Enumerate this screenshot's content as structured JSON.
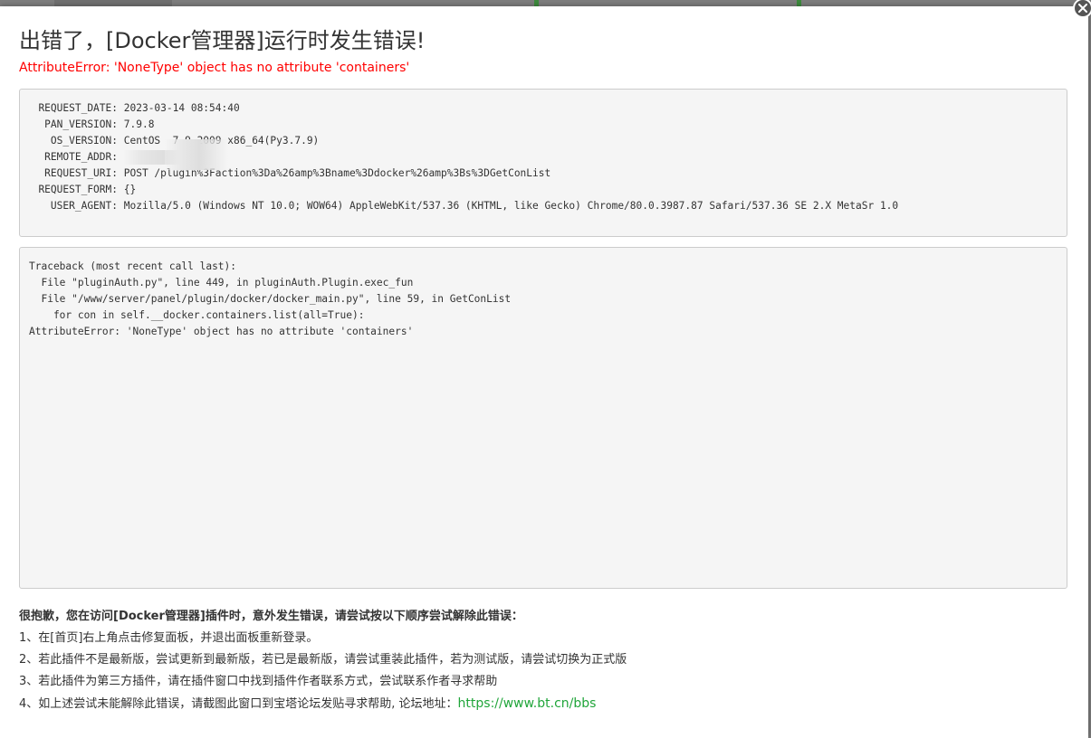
{
  "dialog": {
    "title": "出错了，[Docker管理器]运行时发生错误!",
    "error_message": "AttributeError: 'NoneType' object has no attribute 'containers'"
  },
  "request_info": [
    {
      "key": "REQUEST_DATE:",
      "value": "2023-03-14 08:54:40"
    },
    {
      "key": "PAN_VERSION:",
      "value": "7.9.8"
    },
    {
      "key": "OS_VERSION:",
      "value": "CentOS  7.9.2009 x86_64(Py3.7.9)"
    },
    {
      "key": "REMOTE_ADDR:",
      "value": ""
    },
    {
      "key": "REQUEST_URI:",
      "value": "POST /plugin%3Faction%3Da%26amp%3Bname%3Ddocker%26amp%3Bs%3DGetConList"
    },
    {
      "key": "REQUEST_FORM:",
      "value": "{}"
    },
    {
      "key": "USER_AGENT:",
      "value": "Mozilla/5.0 (Windows NT 10.0; WOW64) AppleWebKit/537.36 (KHTML, like Gecko) Chrome/80.0.3987.87 Safari/537.36 SE 2.X MetaSr 1.0"
    }
  ],
  "traceback": [
    "Traceback (most recent call last):",
    "  File \"pluginAuth.py\", line 449, in pluginAuth.Plugin.exec_fun",
    "  File \"/www/server/panel/plugin/docker/docker_main.py\", line 59, in GetConList",
    "    for con in self.__docker.containers.list(all=True):",
    "AttributeError: 'NoneType' object has no attribute 'containers'"
  ],
  "help": {
    "title": "很抱歉，您在访问[Docker管理器]插件时，意外发生错误，请尝试按以下顺序尝试解除此错误：",
    "items": [
      "1、在[首页]右上角点击修复面板，并退出面板重新登录。",
      "2、若此插件不是最新版，尝试更新到最新版，若已是最新版，请尝试重装此插件，若为测试版，请尝试切换为正式版",
      "3、若此插件为第三方插件，请在插件窗口中找到插件作者联系方式，尝试联系作者寻求帮助",
      "4、如上述尝试未能解除此错误，请截图此窗口到宝塔论坛发贴寻求帮助, 论坛地址："
    ],
    "forum_link": "https://www.bt.cn/bbs"
  },
  "colors": {
    "error": "#ff0000",
    "link": "#20a53a",
    "code_bg": "#f5f5f5"
  },
  "icons": {
    "close": "close-icon"
  }
}
